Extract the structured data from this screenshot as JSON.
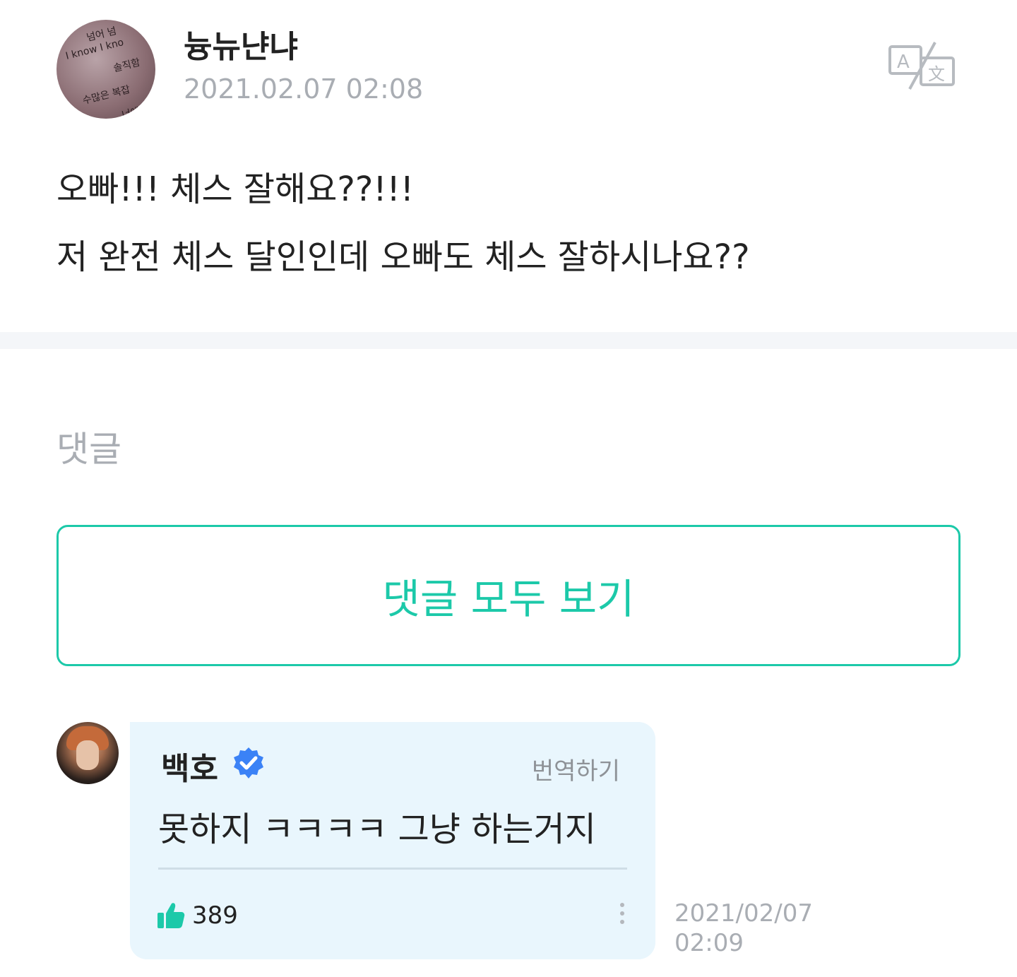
{
  "post": {
    "author": "늉뉴냔냐",
    "date": "2021.02.07 02:08",
    "avatar_text": [
      "넘어 넘",
      "I know I kno",
      "솔직함",
      "수많은 복잡",
      "너에게"
    ],
    "body_lines": [
      "오빠!!! 체스 잘해요??!!!",
      "저 완전 체스 달인인데 오빠도 체스 잘하시나요??"
    ],
    "translate_icon": "translate-icon"
  },
  "comments_section": {
    "label": "댓글",
    "view_all_label": "댓글 모두 보기"
  },
  "comment": {
    "author": "백호",
    "verified_icon": "verified-badge-icon",
    "translate_label": "번역하기",
    "text": "못하지 ㅋㅋㅋㅋ 그냥 하는거지",
    "likes": "389",
    "date_line1": "2021/02/07",
    "date_line2": "02:09"
  },
  "colors": {
    "accent": "#1cc9a9",
    "verified": "#3b82f6",
    "muted": "#a9adb3",
    "bubble_bg": "#e9f6fd"
  }
}
